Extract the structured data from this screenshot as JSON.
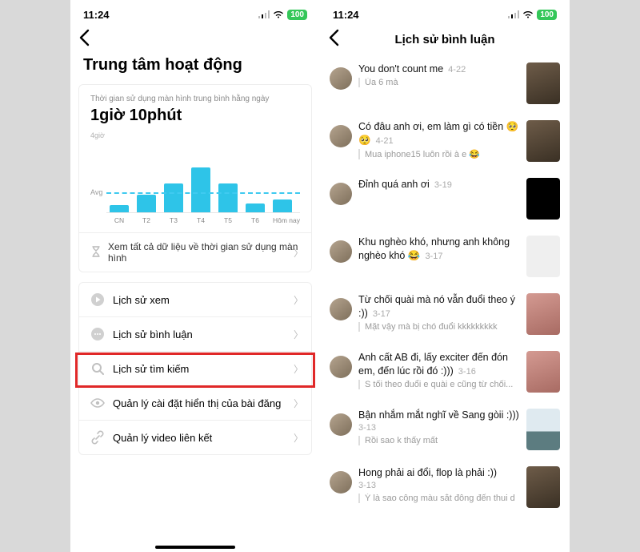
{
  "status": {
    "time": "11:24",
    "battery": "100"
  },
  "left": {
    "page_title": "Trung tâm hoạt động",
    "screen_label": "Thời gian sử dụng màn hình trung bình hằng ngày",
    "screen_value": "1giờ 10phút",
    "y_axis_max_label": "4giờ",
    "avg_label": "Avg",
    "footer_text": "Xem tất cả dữ liệu về thời gian sử dụng màn hình",
    "menu": [
      {
        "icon": "play",
        "label": "Lịch sử xem"
      },
      {
        "icon": "comment",
        "label": "Lịch sử bình luận"
      },
      {
        "icon": "search",
        "label": "Lịch sử tìm kiếm"
      },
      {
        "icon": "eye",
        "label": "Quản lý cài đặt hiển thị của bài đăng"
      },
      {
        "icon": "link",
        "label": "Quản lý video liên kết"
      }
    ]
  },
  "right": {
    "title": "Lịch sử bình luận",
    "comments": [
      {
        "text": "You don't count me",
        "date": "4-22",
        "reply": "Ủa 6 mà",
        "thumb": ""
      },
      {
        "text": "Có đâu anh ơi, em làm gì có tiền 🥺🥺",
        "date": "4-21",
        "reply": "Mua iphone15 luôn rồi à e 😂",
        "thumb": ""
      },
      {
        "text": "Đỉnh quá anh ơi",
        "date": "3-19",
        "reply": "",
        "thumb": "black"
      },
      {
        "text": "Khu nghèo khó, nhưng anh không nghèo khó 😂",
        "date": "3-17",
        "reply": "",
        "thumb": "grey"
      },
      {
        "text": "Từ chối quài mà nó vẫn đuổi theo ý :))",
        "date": "3-17",
        "reply": "Mặt vậy mà bị chó đuổi kkkkkkkkk",
        "thumb": "pink"
      },
      {
        "text": "Anh cất AB đi, lấy exciter đến đón em, đến lúc rồi đó :)))",
        "date": "3-16",
        "reply": "S tối theo đuổi e quài e cũng từ chối...",
        "thumb": "pink"
      },
      {
        "text": "Bận nhắm mắt nghĩ về Sang gòii :)))",
        "date": "3-13",
        "reply": "Rồi sao k thấy mất",
        "thumb": "land"
      },
      {
        "text": "Hong phải ai đổi, flop là phải :))",
        "date": "3-13",
        "reply": "Ý là sao công màu sắt đông đến thui d",
        "thumb": ""
      }
    ]
  },
  "chart_data": {
    "type": "bar",
    "title": "Thời gian sử dụng màn hình trung bình hằng ngày",
    "ylabel": "giờ",
    "ylim": [
      0,
      4
    ],
    "avg": 1.17,
    "categories": [
      "CN",
      "T2",
      "T3",
      "T4",
      "T5",
      "T6",
      "Hôm nay"
    ],
    "values": [
      0.4,
      1.0,
      1.6,
      2.5,
      1.6,
      0.5,
      0.7
    ]
  }
}
